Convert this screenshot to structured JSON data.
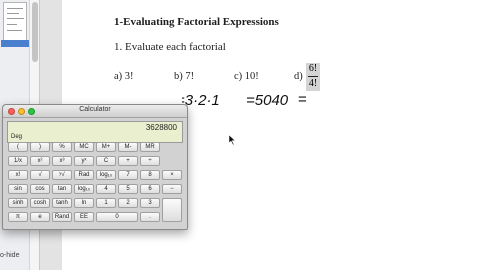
{
  "document": {
    "title": "1-Evaluating Factorial Expressions",
    "instruction": "1. Evaluate each factorial",
    "problems": [
      {
        "label": "a)",
        "expr": "3!"
      },
      {
        "label": "b)",
        "expr": "7!"
      },
      {
        "label": "c)",
        "expr": "10!"
      },
      {
        "label": "d)",
        "numerator": "6!",
        "denominator": "4!"
      }
    ],
    "handwriting": {
      "a": "=3·2·1",
      "b": "=5040",
      "c": "="
    }
  },
  "calculator": {
    "title": "Calculator",
    "display": "3628800",
    "mode": "Deg",
    "keys": [
      [
        "(",
        ")",
        "%",
        "MC",
        "M+",
        "M-",
        "MR"
      ],
      [
        "1/x",
        "x²",
        "x³",
        "yˣ",
        "C",
        "+",
        "÷"
      ],
      [
        "x!",
        "√",
        "ʸ√",
        "Rad",
        "log₁₀",
        "7",
        "8",
        "9",
        "×"
      ],
      [
        "sin",
        "cos",
        "tan",
        "log₁₀",
        "4",
        "5",
        "6",
        "−"
      ],
      [
        "sinh",
        "cosh",
        "tanh",
        "ln",
        "1",
        "2",
        "3",
        "+"
      ],
      [
        "π",
        "e",
        "Rand",
        "EE",
        "0",
        ".",
        ""
      ]
    ]
  },
  "sidebar": {
    "footer": "o-hide"
  },
  "colors": {
    "display_bg": "#eaf0cf",
    "close": "#ff5f57",
    "minimize": "#febc2e",
    "zoom": "#28c840",
    "highlight": "#4a7fd0"
  },
  "icons": [
    "close-icon",
    "minimize-icon",
    "zoom-icon",
    "pointer-cursor-icon"
  ]
}
